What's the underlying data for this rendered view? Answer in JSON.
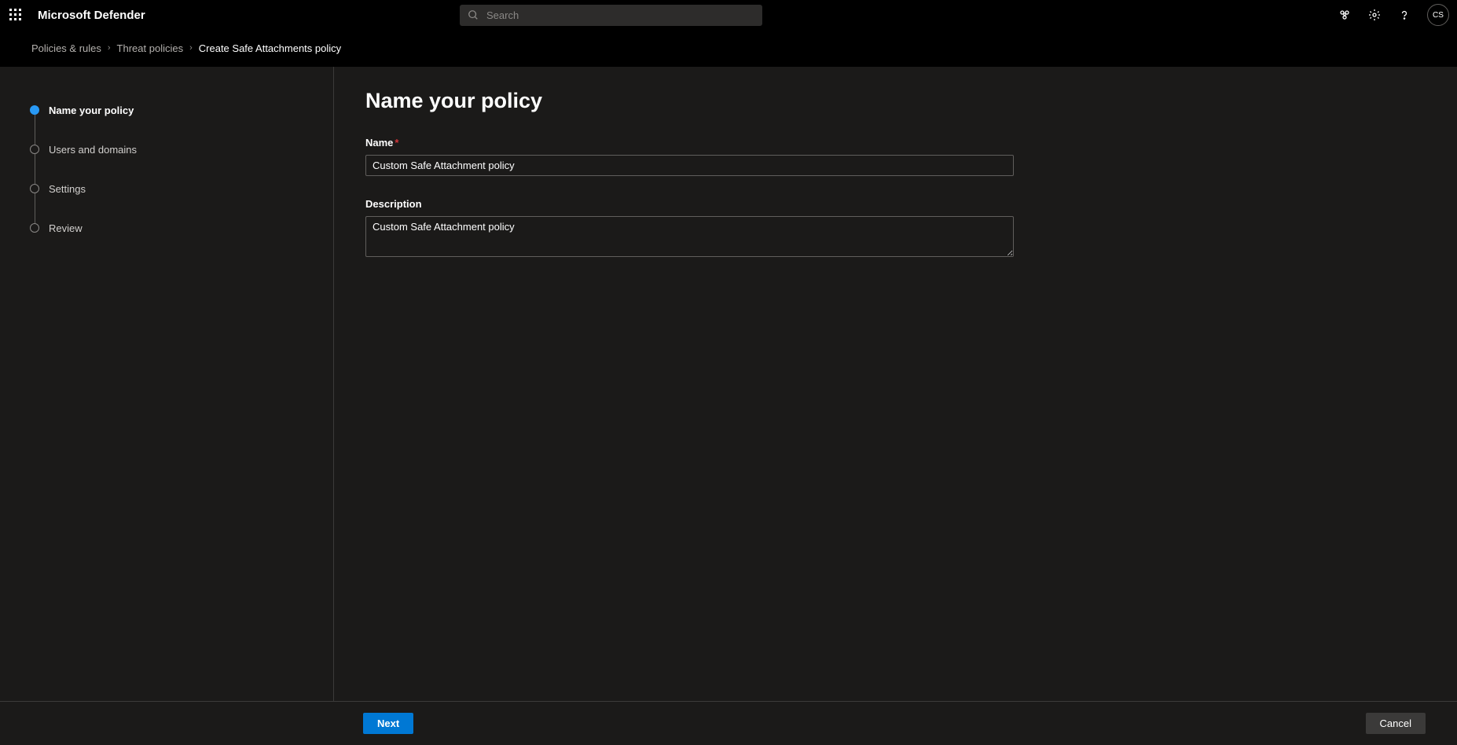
{
  "header": {
    "app_title": "Microsoft Defender",
    "search_placeholder": "Search",
    "avatar_initials": "CS"
  },
  "breadcrumb": {
    "item1": "Policies & rules",
    "item2": "Threat policies",
    "item3": "Create Safe Attachments policy"
  },
  "steps": {
    "item1": "Name your policy",
    "item2": "Users and domains",
    "item3": "Settings",
    "item4": "Review"
  },
  "page": {
    "heading": "Name your policy",
    "name_label": "Name",
    "name_value": "Custom Safe Attachment policy",
    "description_label": "Description",
    "description_value": "Custom Safe Attachment policy"
  },
  "footer": {
    "next_label": "Next",
    "cancel_label": "Cancel"
  }
}
